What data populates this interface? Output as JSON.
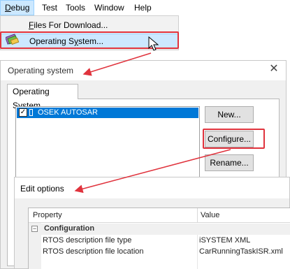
{
  "menubar": {
    "items": [
      {
        "label_acc": "D",
        "label_rest": "ebug",
        "active": true
      },
      {
        "label": "Test"
      },
      {
        "label": "Tools"
      },
      {
        "label": "Window"
      },
      {
        "label": "Help"
      }
    ]
  },
  "dropdown": {
    "files_acc": "F",
    "files_rest": "iles For Download...",
    "os_pre": "Operating S",
    "os_acc": "y",
    "os_post": "stem..."
  },
  "os_dialog": {
    "title": "Operating system",
    "tab_label": "Operating System",
    "list_item_label": "OSEK AUTOSAR",
    "new_button": "New...",
    "configure_button": "Configure...",
    "rename_button": "Rename..."
  },
  "edit_dialog": {
    "title": "Edit options",
    "columns": {
      "property": "Property",
      "value": "Value"
    },
    "category": "Configuration",
    "rows": [
      {
        "name": "RTOS description file type",
        "value": "iSYSTEM XML"
      },
      {
        "name": "RTOS description file location",
        "value": "CarRunningTaskISR.xml"
      }
    ]
  },
  "colors": {
    "highlight": "#cce8ff",
    "selection": "#0078d7",
    "annotation": "#e0333d"
  }
}
